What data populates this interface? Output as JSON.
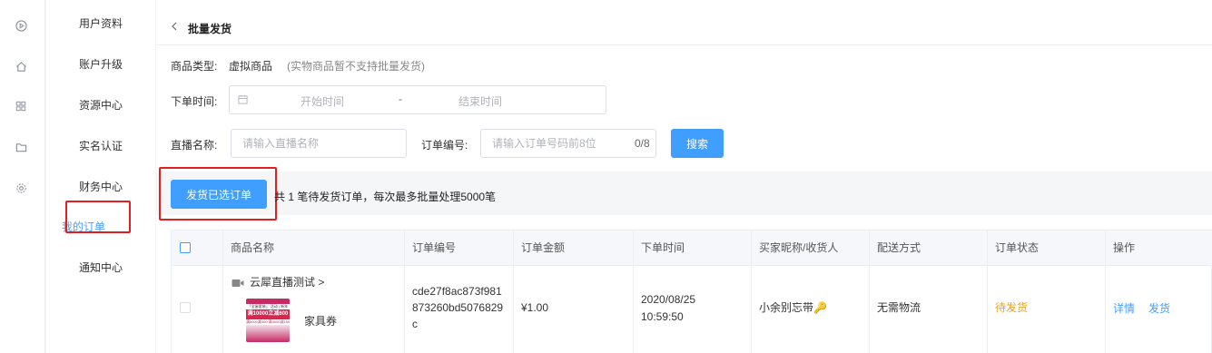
{
  "side_menu": {
    "items": [
      {
        "label": "用户资料"
      },
      {
        "label": "账户升级"
      },
      {
        "label": "资源中心"
      },
      {
        "label": "实名认证"
      },
      {
        "label": "财务中心"
      },
      {
        "label": "我的订单",
        "active": true
      },
      {
        "label": "通知中心"
      }
    ]
  },
  "header": {
    "title": "批量发货"
  },
  "filters": {
    "product_type_label": "商品类型:",
    "product_type_value": "虚拟商品",
    "product_type_hint": "(实物商品暂不支持批量发货)",
    "order_time_label": "下单时间:",
    "start_placeholder": "开始时间",
    "range_separator": "-",
    "end_placeholder": "结束时间",
    "live_name_label": "直播名称:",
    "live_name_placeholder": "请输入直播名称",
    "order_no_label": "订单编号:",
    "order_no_placeholder": "请输入订单号码前8位",
    "order_no_counter": "0/8",
    "search_button": "搜索"
  },
  "batch": {
    "ship_button": "发货已选订单",
    "info": "共 1 笔待发货订单，每次最多批量处理5000笔"
  },
  "table": {
    "columns": [
      "商品名称",
      "订单编号",
      "订单金额",
      "下单时间",
      "买家昵称/收货人",
      "配送方式",
      "订单状态",
      "操作"
    ],
    "rows": [
      {
        "product_live": "云犀直播测试 >",
        "product_name": "家具券",
        "order_no_line1": "cde27f8ac873f981",
        "order_no_line2": "873260bd5076829",
        "order_no_line3": "c",
        "amount": "¥1.00",
        "date": "2020/08/25",
        "time": "10:59:50",
        "buyer": "小余别忘带🔑",
        "delivery": "无需物流",
        "status": "待发货",
        "actions": {
          "detail": "详情",
          "ship": "发货"
        }
      }
    ]
  },
  "thumbnail": {
    "line1": "「全屋套装」 活动 | 新年",
    "line2": "满10000立减600",
    "line3": "满5000减300 满3000减150"
  },
  "colors": {
    "accent": "#409eff",
    "highlight": "#e02020",
    "status_pending": "#f0a020"
  }
}
